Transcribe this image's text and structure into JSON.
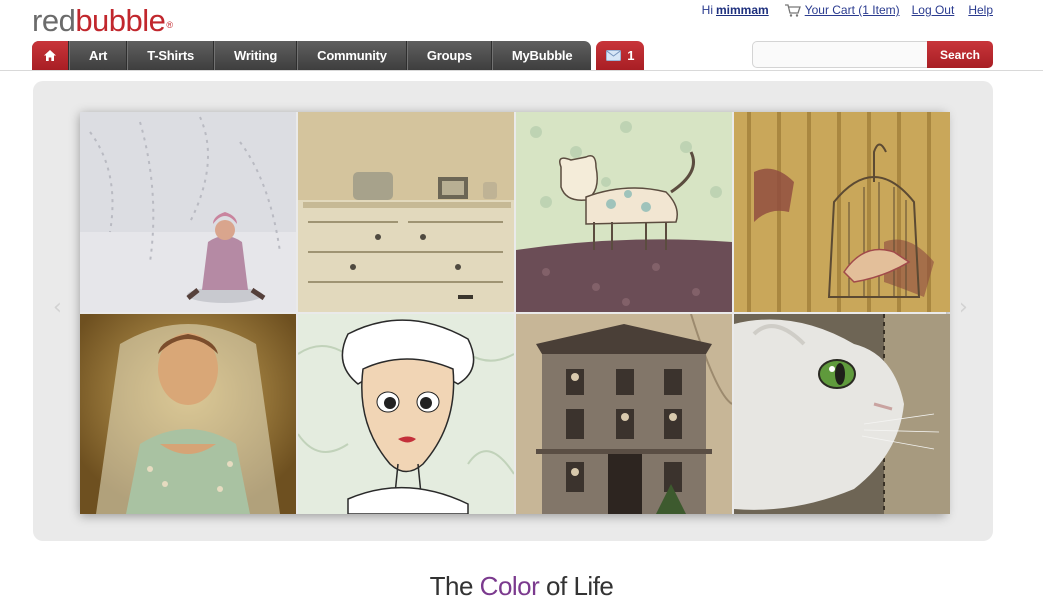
{
  "logo": {
    "part1": "red",
    "part2": "bubble",
    "reg": "®"
  },
  "userbar": {
    "greeting": "Hi",
    "username": "mimmam",
    "cart": "Your Cart (1 Item)",
    "logout": "Log Out",
    "help": "Help"
  },
  "nav": {
    "items": [
      "Art",
      "T-Shirts",
      "Writing",
      "Community",
      "Groups",
      "MyBubble"
    ],
    "message_count": "1"
  },
  "search": {
    "button": "Search",
    "placeholder": ""
  },
  "gallery": {
    "prev": "‹",
    "next": "›",
    "tiles": [
      "girl-in-snow",
      "vintage-dresser",
      "cat-illustration",
      "birdcage-wallpaper",
      "bride-portrait",
      "girl-illustration",
      "victorian-house",
      "white-cat"
    ]
  },
  "tagline": {
    "before": "The",
    "accent": "Color",
    "after": "of Life"
  },
  "colors": {
    "brand_red": "#c1272d",
    "nav_grey": "#4f4f4f",
    "link": "#2a3b8f",
    "accent": "#7b3a8e"
  }
}
